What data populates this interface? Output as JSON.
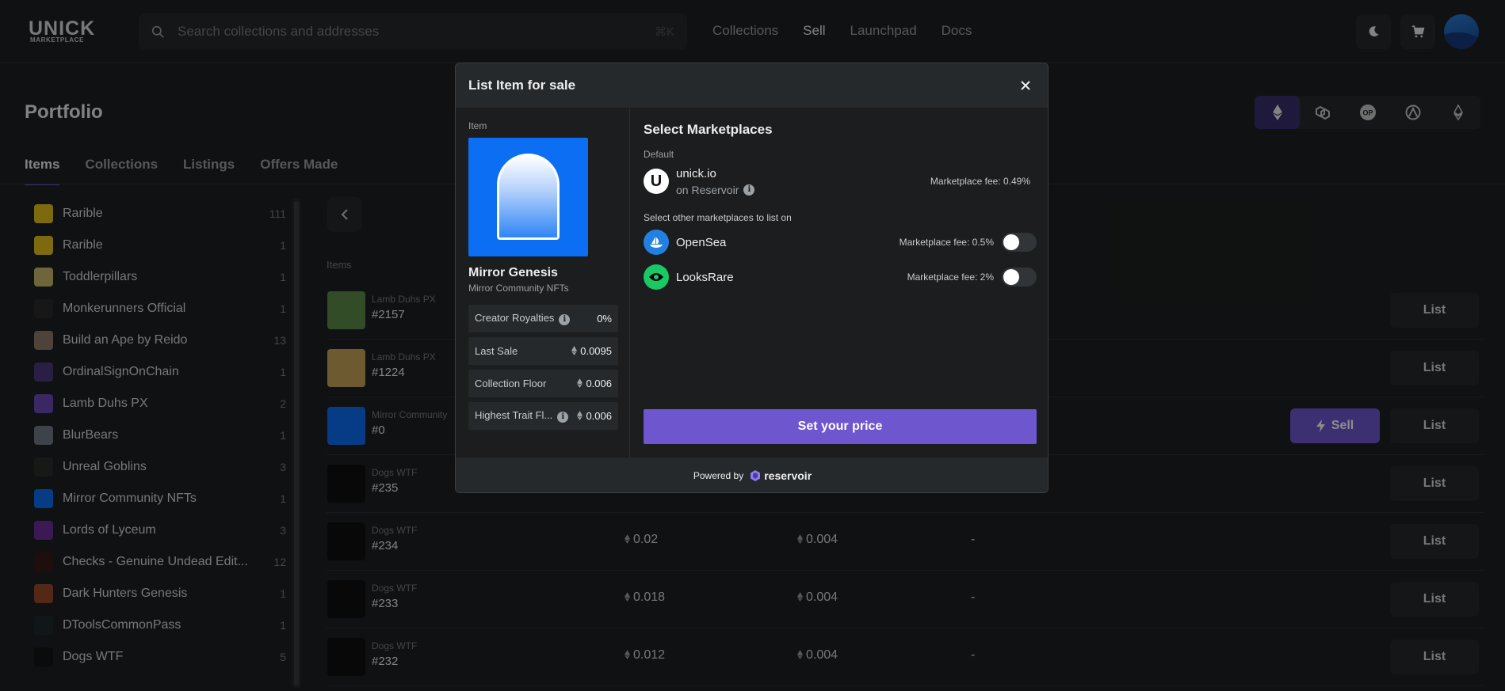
{
  "header": {
    "logo_text": "UNICK",
    "logo_sub": "MARKETPLACE",
    "search_placeholder": "Search collections and addresses",
    "search_shortcut": "⌘K",
    "nav": [
      "Collections",
      "Sell",
      "Launchpad",
      "Docs"
    ],
    "nav_active": "Sell"
  },
  "portfolio": {
    "title": "Portfolio",
    "tabs": [
      "Items",
      "Collections",
      "Listings",
      "Offers Made"
    ],
    "active_tab": "Items",
    "chains": [
      "ethereum-icon",
      "polygon-icon",
      "optimism-icon",
      "arbitrum-icon",
      "base-icon"
    ]
  },
  "sidebar": {
    "items": [
      {
        "name": "Rarible",
        "count": "111",
        "color": "#e3c11b"
      },
      {
        "name": "Rarible",
        "count": "1",
        "color": "#e3c11b"
      },
      {
        "name": "Toddlerpillars",
        "count": "1",
        "color": "#c9b86b"
      },
      {
        "name": "Monkerunners Official",
        "count": "1",
        "color": "#2b2b2b"
      },
      {
        "name": "Build an Ape by Reido",
        "count": "13",
        "color": "#8d7a6a"
      },
      {
        "name": "OrdinalSignOnChain",
        "count": "1",
        "color": "#4b3a7a"
      },
      {
        "name": "Lamb Duhs PX",
        "count": "2",
        "color": "#6a4ab8"
      },
      {
        "name": "BlurBears",
        "count": "1",
        "color": "#6f7a86"
      },
      {
        "name": "Unreal Goblins",
        "count": "3",
        "color": "#2a2f2a"
      },
      {
        "name": "Mirror Community NFTs",
        "count": "1",
        "color": "#0c6ef2"
      },
      {
        "name": "Lords of Lyceum",
        "count": "3",
        "color": "#6b2e9c"
      },
      {
        "name": "Checks - Genuine Undead Edit...",
        "count": "12",
        "color": "#3a1a1a"
      },
      {
        "name": "Dark Hunters Genesis",
        "count": "1",
        "color": "#9a4a2a"
      },
      {
        "name": "DToolsCommonPass",
        "count": "1",
        "color": "#202a2e"
      },
      {
        "name": "Dogs WTF",
        "count": "5",
        "color": "#141414"
      }
    ]
  },
  "table": {
    "items_header": "Items",
    "rows": [
      {
        "collection": "Lamb Duhs PX",
        "token": "#2157",
        "price1": "",
        "price2": "",
        "dash": "",
        "sell": false,
        "color": "#5d8a4a"
      },
      {
        "collection": "Lamb Duhs PX",
        "token": "#1224",
        "price1": "",
        "price2": "",
        "dash": "",
        "sell": false,
        "color": "#c8a55a"
      },
      {
        "collection": "Mirror Community",
        "token": "#0",
        "price1": "",
        "price2": "",
        "dash": "",
        "sell": true,
        "color": "#0c6ef2"
      },
      {
        "collection": "Dogs WTF",
        "token": "#235",
        "price1": "",
        "price2": "",
        "dash": "",
        "sell": false,
        "color": "#0f0f0f"
      },
      {
        "collection": "Dogs WTF",
        "token": "#234",
        "price1": "0.02",
        "price2": "0.004",
        "dash": "-",
        "sell": false,
        "color": "#0f0f0f"
      },
      {
        "collection": "Dogs WTF",
        "token": "#233",
        "price1": "0.018",
        "price2": "0.004",
        "dash": "-",
        "sell": false,
        "color": "#0f0f0f"
      },
      {
        "collection": "Dogs WTF",
        "token": "#232",
        "price1": "0.012",
        "price2": "0.004",
        "dash": "-",
        "sell": false,
        "color": "#0f0f0f"
      }
    ],
    "list_label": "List",
    "sell_label": "Sell"
  },
  "modal": {
    "title": "List Item for sale",
    "item_label": "Item",
    "nft_name": "Mirror Genesis",
    "nft_collection": "Mirror Community NFTs",
    "stats": [
      {
        "label": "Creator Royalties",
        "value": "0%",
        "info": true,
        "eth": false
      },
      {
        "label": "Last Sale",
        "value": "0.0095",
        "info": false,
        "eth": true
      },
      {
        "label": "Collection Floor",
        "value": "0.006",
        "info": false,
        "eth": true
      },
      {
        "label": "Highest Trait Fl...",
        "value": "0.006",
        "info": true,
        "eth": true
      }
    ],
    "select_title": "Select Marketplaces",
    "default_label": "Default",
    "default_market": {
      "name": "unick.io",
      "sub": "on Reservoir",
      "fee": "Marketplace fee: 0.49%"
    },
    "other_label": "Select other marketplaces to list on",
    "other_markets": [
      {
        "name": "OpenSea",
        "fee": "Marketplace fee: 0.5%",
        "color": "#2081e2",
        "icon": "opensea-icon"
      },
      {
        "name": "LooksRare",
        "fee": "Marketplace fee: 2%",
        "color": "#18c964",
        "icon": "looksrare-icon"
      }
    ],
    "cta": "Set your price",
    "powered_by": "Powered by",
    "brand": "reservoir"
  }
}
